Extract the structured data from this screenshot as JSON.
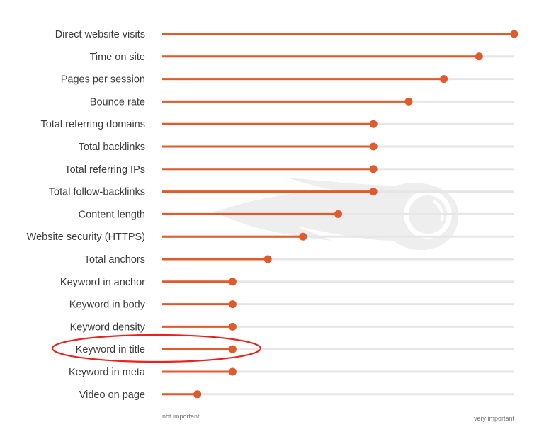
{
  "chart_data": {
    "type": "bar",
    "style": "lollipop-horizontal",
    "title": "",
    "xlabel": "",
    "ylabel": "",
    "scale_min_label": "not important",
    "scale_max_label": "very important",
    "xlim": [
      0,
      10
    ],
    "grid": false,
    "categories": [
      "Direct website visits",
      "Time on site",
      "Pages per session",
      "Bounce rate",
      "Total referring domains",
      "Total backlinks",
      "Total referring IPs",
      "Total follow-backlinks",
      "Content length",
      "Website security (HTTPS)",
      "Total anchors",
      "Keyword in anchor",
      "Keyword in body",
      "Keyword density",
      "Keyword in title",
      "Keyword in meta",
      "Video on page"
    ],
    "values": [
      10,
      9,
      8,
      7,
      6,
      6,
      6,
      6,
      5,
      4,
      3,
      2,
      2,
      2,
      2,
      2,
      1
    ],
    "highlighted_category": "Keyword in title",
    "colors": {
      "bar": "#e05a2b",
      "track": "#e6e6e6",
      "highlight_ellipse": "#e8231c",
      "label": "#3c3c3c",
      "axis_label": "#777777",
      "watermark": "#eeeeee"
    },
    "watermark_icon": "semrush-fireball-logo"
  }
}
